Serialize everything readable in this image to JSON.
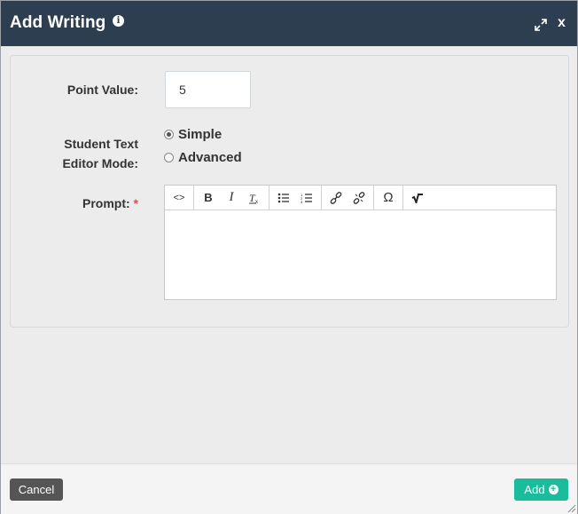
{
  "dialog": {
    "title": "Add Writing",
    "info_icon": "info-icon",
    "expand_icon": "expand-icon",
    "close_label": "x"
  },
  "form": {
    "point_value_label": "Point Value:",
    "point_value": "5",
    "mode_label_line1": "Student Text",
    "mode_label_line2": "Editor Mode:",
    "mode_options": [
      {
        "label": "Simple",
        "selected": true
      },
      {
        "label": "Advanced",
        "selected": false
      }
    ],
    "prompt_label": "Prompt:",
    "required_mark": "*"
  },
  "toolbar": {
    "source_icon": "<>",
    "bold": "B",
    "italic": "I",
    "clear_format": "Tx",
    "bullet_icon": "bulleted-list-icon",
    "numbered_icon": "numbered-list-icon",
    "link_icon": "link-icon",
    "unlink_icon": "unlink-icon",
    "special_char": "Ω",
    "math_icon": "square-root-icon"
  },
  "footer": {
    "cancel_label": "Cancel",
    "add_label": "Add"
  },
  "colors": {
    "titlebar": "#2c3e50",
    "add_button": "#1abc9c",
    "cancel_button": "#555555",
    "required": "#d9534f"
  }
}
